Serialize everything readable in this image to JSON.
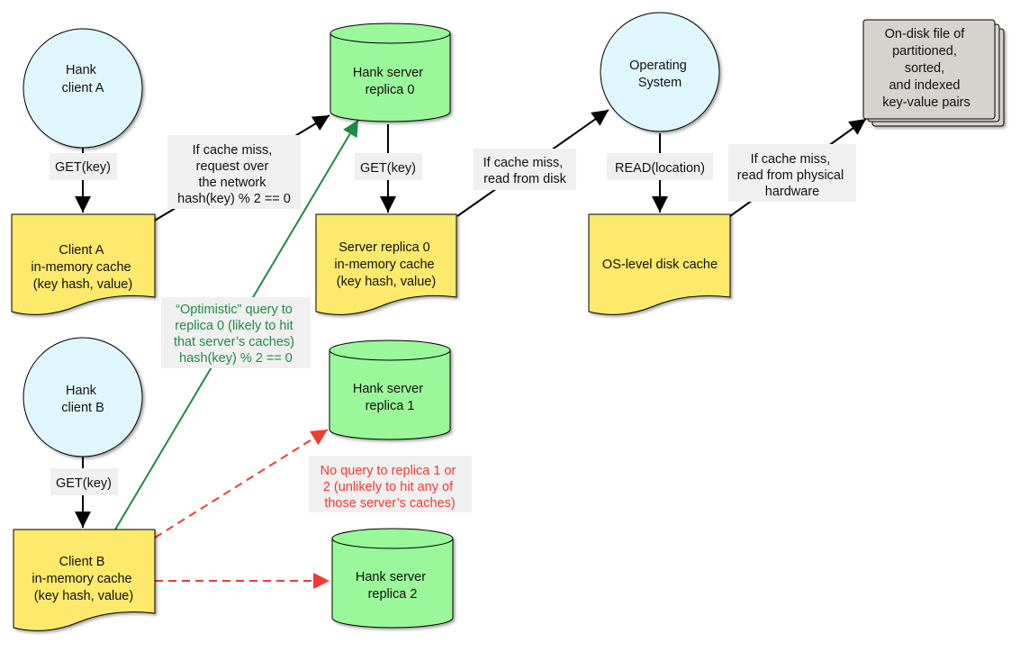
{
  "colors": {
    "client_fill": "#dff6fd",
    "server_fill": "#9af79a",
    "cache_fill": "#fde96c",
    "disk_fill": "#d6d2ce",
    "edge_black": "#000000",
    "edge_green": "#1f8a45",
    "edge_red": "#ef3b33",
    "label_bg": "#f0f0f0"
  },
  "nodes": {
    "client_a": [
      "Hank",
      "client A"
    ],
    "client_b": [
      "Hank",
      "client B"
    ],
    "operating_system": [
      "Operating",
      "System"
    ],
    "server_replica_0": [
      "Hank server",
      "replica 0"
    ],
    "server_replica_1": [
      "Hank server",
      "replica 1"
    ],
    "server_replica_2": [
      "Hank server",
      "replica 2"
    ],
    "client_a_cache": [
      "Client A",
      "in-memory cache",
      "(key hash, value)"
    ],
    "client_b_cache": [
      "Client B",
      "in-memory cache",
      "(key hash, value)"
    ],
    "server_cache": [
      "Server replica 0",
      "in-memory cache",
      "(key hash, value)"
    ],
    "os_cache": [
      "OS-level disk cache"
    ],
    "disk_file": [
      "On-disk file of",
      "partitioned,",
      "sorted,",
      "and indexed",
      "key-value pairs"
    ]
  },
  "edge_labels": {
    "client_a_get": [
      "GET(key)"
    ],
    "client_b_get": [
      "GET(key)"
    ],
    "server_get": [
      "GET(key)"
    ],
    "os_read": [
      "READ(location)"
    ],
    "network_request": [
      "If cache miss,",
      "request over",
      "the network",
      "hash(key) % 2 == 0"
    ],
    "read_disk": [
      "If cache miss,",
      "read from disk"
    ],
    "read_hardware": [
      "If cache miss,",
      "read from physical",
      "hardware"
    ],
    "optimistic_query": [
      "“Optimistic” query to",
      "replica 0 (likely to hit",
      "that server’s caches)",
      "hash(key) % 2 == 0"
    ],
    "no_query": [
      "No query to replica 1 or",
      "2 (unlikely to hit any of",
      "those server’s caches)"
    ]
  }
}
